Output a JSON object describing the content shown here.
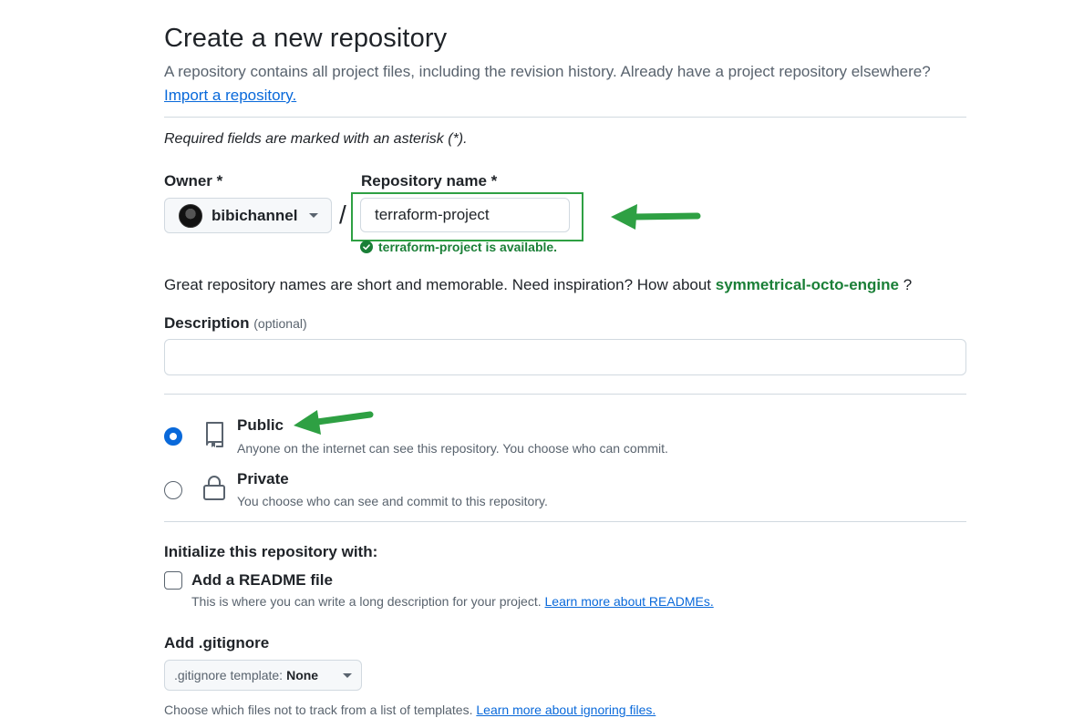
{
  "page": {
    "title": "Create a new repository",
    "subtitle": "A repository contains all project files, including the revision history. Already have a project repository elsewhere?",
    "import_link": "Import a repository.",
    "required_note": "Required fields are marked with an asterisk (*)."
  },
  "owner": {
    "label": "Owner *",
    "name": "bibichannel"
  },
  "repo_name": {
    "label": "Repository name *",
    "value": "terraform-project",
    "availability": "terraform-project is available."
  },
  "inspiration": {
    "text": "Great repository names are short and memorable. Need inspiration? How about",
    "suggestion": "symmetrical-octo-engine",
    "suffix": "?"
  },
  "description": {
    "label": "Description",
    "optional": "(optional)",
    "value": ""
  },
  "visibility": {
    "public": {
      "label": "Public",
      "desc": "Anyone on the internet can see this repository. You choose who can commit."
    },
    "private": {
      "label": "Private",
      "desc": "You choose who can see and commit to this repository."
    },
    "selected": "public"
  },
  "initialize": {
    "title": "Initialize this repository with:",
    "readme_label": "Add a README file",
    "readme_desc": "This is where you can write a long description for your project.",
    "readme_link": "Learn more about READMEs.",
    "readme_checked": false
  },
  "gitignore": {
    "title": "Add .gitignore",
    "select_prefix": ".gitignore template:",
    "select_value": "None",
    "help": "Choose which files not to track from a list of templates.",
    "help_link": "Learn more about ignoring files."
  },
  "colors": {
    "accent_blue": "#0969da",
    "success_green": "#1a7f37",
    "annotation_green": "#2ea043"
  },
  "icons": {
    "owner_dropdown": "chevron-down-icon",
    "available": "check-circle-icon",
    "public": "repo-icon",
    "private": "lock-icon",
    "annotation": "arrow-left-icon"
  }
}
